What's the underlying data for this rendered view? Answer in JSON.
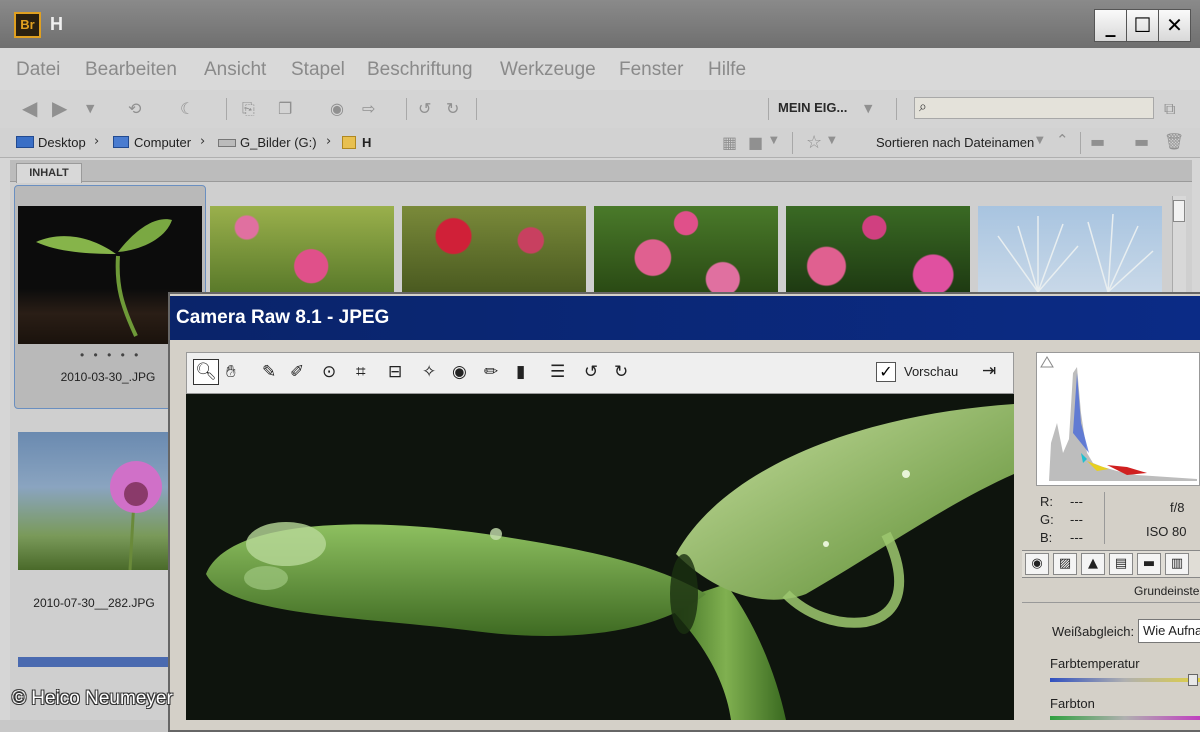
{
  "window": {
    "app_badge": "Br",
    "title": "H",
    "minimize_glyph": "_",
    "maximize_glyph": "☐",
    "close_glyph": "✕"
  },
  "menu": [
    "Datei",
    "Bearbeiten",
    "Ansicht",
    "Stapel",
    "Beschriftung",
    "Werkzeuge",
    "Fenster",
    "Hilfe"
  ],
  "toolbar": {
    "workspace_label": "MEIN EIG...",
    "search_placeholder": ""
  },
  "path": {
    "items": [
      "Desktop",
      "Computer",
      "G_Bilder (G:)",
      "H"
    ]
  },
  "sort": {
    "label": "Sortieren nach Dateinamen"
  },
  "panel": {
    "tab_label": "INHALT"
  },
  "thumbnails": [
    {
      "label": "2010-03-30_.JPG",
      "rating_dots": "• • • • •",
      "icon": "seedling-thumbnail"
    },
    {
      "label": "",
      "icon": "pink-flower-thumbnail"
    },
    {
      "label": "",
      "icon": "red-flower-thumbnail"
    },
    {
      "label": "",
      "icon": "pink-flower-thumbnail"
    },
    {
      "label": "",
      "icon": "pink-flower-thumbnail"
    },
    {
      "label": "",
      "icon": "white-umbel-thumbnail"
    },
    {
      "label": "2010-07-30__282.JPG",
      "icon": "thistle-thumbnail"
    }
  ],
  "camera_raw": {
    "title": "Camera Raw 8.1 - JPEG",
    "preview_label": "Vorschau",
    "preview_checked": "✓",
    "readout": {
      "r_label": "R:",
      "r_value": "---",
      "g_label": "G:",
      "g_value": "---",
      "b_label": "B:",
      "b_value": "---",
      "aperture": "f/8",
      "iso": "ISO 80"
    },
    "panel_title": "Grundeinste",
    "white_balance_label": "Weißabgleich:",
    "white_balance_value": "Wie Aufnahme",
    "temperature_label": "Farbtemperatur",
    "tint_label": "Farbton"
  },
  "credit": "© Heico Neumeyer"
}
